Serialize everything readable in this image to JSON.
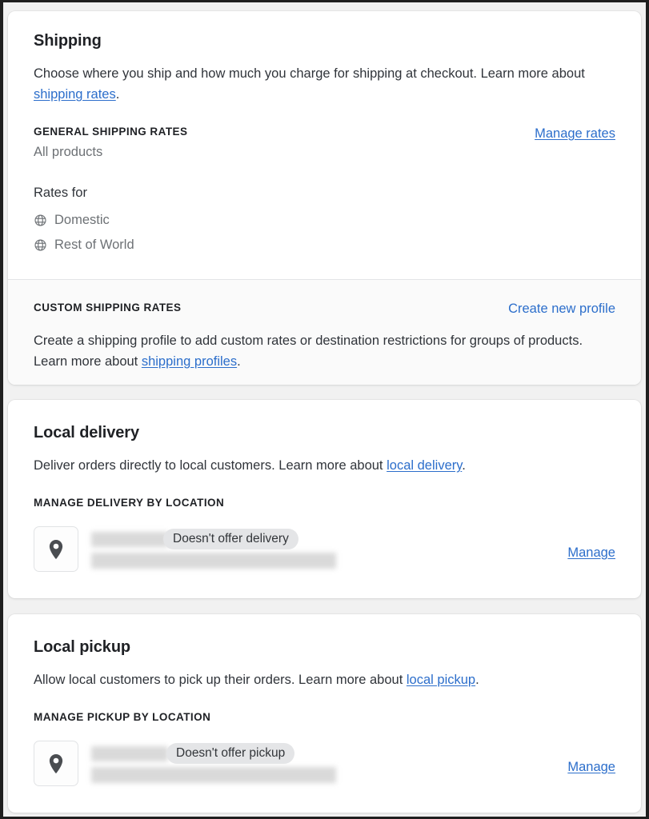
{
  "theme": {
    "link_color": "#2c6ecb",
    "heading_color": "#1f2125",
    "body_color": "#30343a",
    "muted_color": "#6d7175",
    "card_bg": "#ffffff",
    "page_bg": "#f1f1f1",
    "subsection_bg": "#fafafa",
    "badge_bg": "#e4e5e7"
  },
  "shipping": {
    "title": "Shipping",
    "description_part1": "Choose where you ship and how much you charge for shipping at checkout. Learn more about ",
    "description_link": "shipping rates",
    "description_part2": ".",
    "general_rates_label": "GENERAL SHIPPING RATES",
    "general_rates_sublabel": "All products",
    "manage_rates_link": "Manage rates",
    "rates_for_label": "Rates for",
    "rate_zones": [
      {
        "label": "Domestic",
        "icon": "globe-icon"
      },
      {
        "label": "Rest of World",
        "icon": "globe-icon"
      }
    ],
    "custom": {
      "label": "CUSTOM SHIPPING RATES",
      "create_link": "Create new profile",
      "description_part1": "Create a shipping profile to add custom rates or destination restrictions for groups of products. Learn more about ",
      "description_link": "shipping profiles",
      "description_part2": "."
    }
  },
  "local_delivery": {
    "title": "Local delivery",
    "description_part1": "Deliver orders directly to local customers. Learn more about ",
    "description_link": "local delivery",
    "description_part2": ".",
    "section_label": "MANAGE DELIVERY BY LOCATION",
    "location": {
      "icon": "location-pin-icon",
      "name_redacted": true,
      "address_redacted": true,
      "status_badge": "Doesn't offer delivery",
      "manage_link": "Manage"
    }
  },
  "local_pickup": {
    "title": "Local pickup",
    "description_part1": "Allow local customers to pick up their orders. Learn more about ",
    "description_link": "local pickup",
    "description_part2": ".",
    "section_label": "MANAGE PICKUP BY LOCATION",
    "location": {
      "icon": "location-pin-icon",
      "name_redacted": true,
      "address_redacted": true,
      "status_badge": "Doesn't offer pickup",
      "manage_link": "Manage"
    }
  }
}
